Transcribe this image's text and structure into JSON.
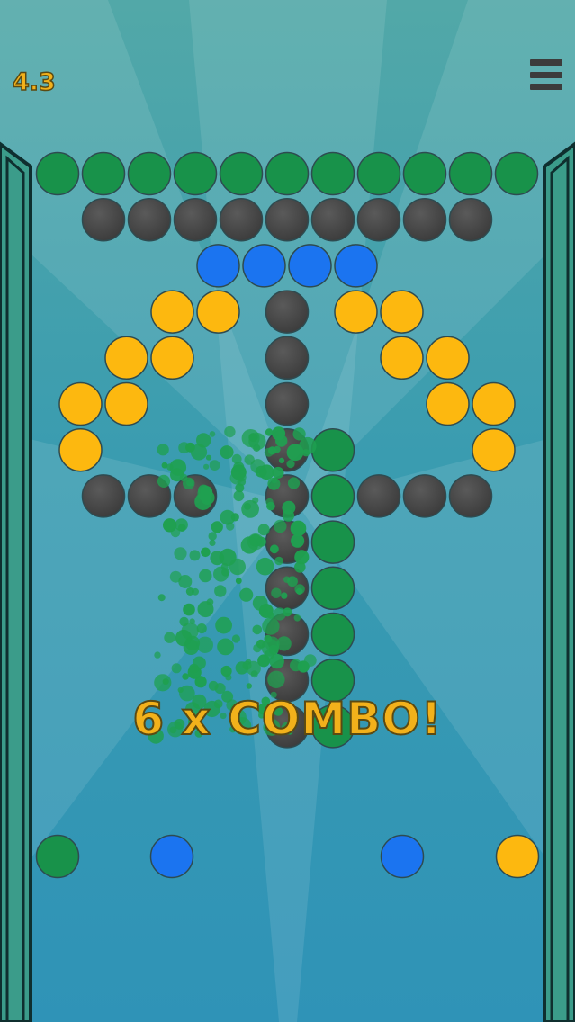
{
  "hud": {
    "score": "4.3",
    "menu_icon": "hamburger-menu-icon"
  },
  "combo": {
    "text": "6 x COMBO!"
  },
  "colors": {
    "green": "#18924a",
    "gray": "#4a4a4a",
    "blue": "#1b74f0",
    "yellow": "#fdb80f",
    "wall": "#3b9c8a",
    "particle": "#1fa050"
  },
  "board": {
    "rows": [
      [
        "G",
        "G",
        "G",
        "G",
        "G",
        "G",
        "G",
        "G",
        "G",
        "G",
        "G"
      ],
      [
        "K",
        "K",
        "K",
        "K",
        "K",
        "K",
        "K",
        "K",
        "K"
      ],
      [
        "B",
        "B",
        "B",
        "B"
      ],
      [
        "Y",
        "Y",
        "K",
        "Y",
        "Y"
      ],
      [
        "Y",
        "Y",
        "K",
        "Y",
        "Y"
      ],
      [
        "Y",
        "Y",
        "K",
        "Y",
        "Y"
      ],
      [
        "Y",
        "K",
        "G",
        "Y"
      ],
      [
        "K",
        "K",
        "K",
        "K",
        "G",
        "K",
        "K",
        "K"
      ],
      [
        "K",
        "G"
      ],
      [
        "K",
        "G"
      ],
      [
        "K",
        "G"
      ],
      [
        "K",
        "G"
      ],
      [
        "K",
        "G"
      ]
    ]
  },
  "launcher_balls": [
    "G",
    "B",
    "B",
    "Y"
  ]
}
